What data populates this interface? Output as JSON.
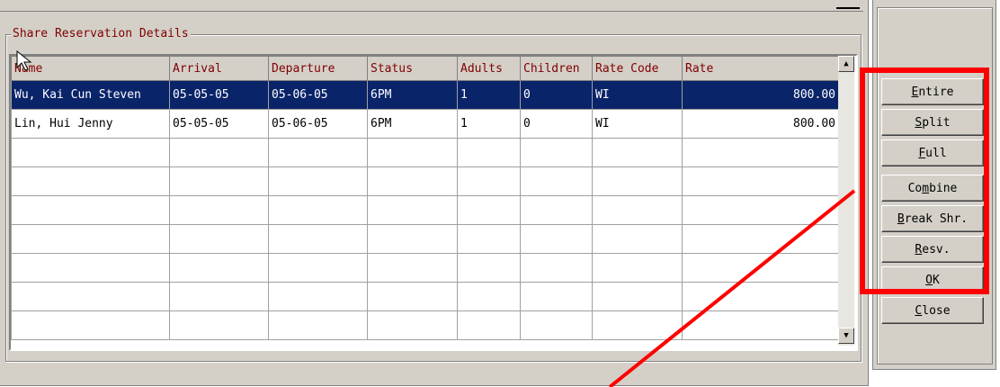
{
  "group_title": "Share Reservation Details",
  "columns": [
    "Name",
    "Arrival",
    "Departure",
    "Status",
    "Adults",
    "Children",
    "Rate Code",
    "Rate"
  ],
  "rows": [
    [
      "Wu, Kai Cun Steven",
      "05-05-05",
      "05-06-05",
      "6PM",
      "1",
      "0",
      "WI",
      "800.00"
    ],
    [
      "Lin, Hui Jenny",
      "05-05-05",
      "05-06-05",
      "6PM",
      "1",
      "0",
      "WI",
      "800.00"
    ]
  ],
  "empty_rows": 7,
  "buttons": [
    {
      "pre": "",
      "u": "E",
      "post": "ntire"
    },
    {
      "pre": "",
      "u": "S",
      "post": "plit"
    },
    {
      "pre": "",
      "u": "F",
      "post": "ull"
    },
    {
      "pre": "Co",
      "u": "m",
      "post": "bine"
    },
    {
      "pre": "",
      "u": "B",
      "post": "reak Shr."
    },
    {
      "pre": "",
      "u": "R",
      "post": "esv."
    },
    {
      "pre": "",
      "u": "O",
      "post": "K"
    },
    {
      "pre": "",
      "u": "C",
      "post": "lose"
    }
  ],
  "colors": {
    "highlight": "#ff0000",
    "selection": "#0a246a",
    "header_text": "#800000"
  },
  "icons": {
    "scroll_up": "arrow-up",
    "scroll_down": "arrow-down",
    "cursor": "mouse-pointer"
  }
}
